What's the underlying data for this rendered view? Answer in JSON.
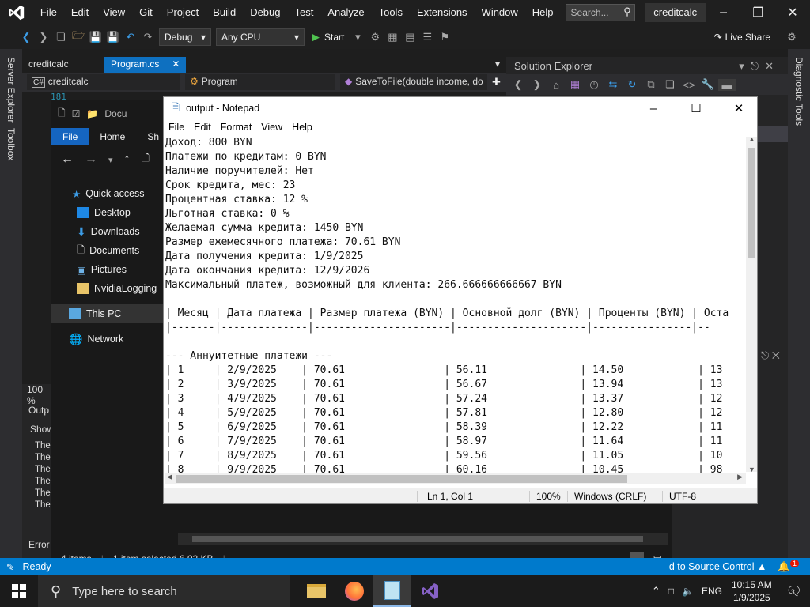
{
  "vs": {
    "menu": [
      "File",
      "Edit",
      "View",
      "Git",
      "Project",
      "Build",
      "Debug",
      "Test",
      "Analyze",
      "Tools",
      "Extensions",
      "Window",
      "Help"
    ],
    "search_placeholder": "Search...",
    "solution_name": "creditcalc",
    "toolbar": {
      "config": "Debug",
      "platform": "Any CPU",
      "start": "Start",
      "live_share": "Live Share"
    },
    "left_strip": [
      "Server Explorer",
      "Toolbox"
    ],
    "right_strip": [
      "Diagnostic Tools"
    ],
    "tabs": [
      {
        "label": "creditcalc"
      },
      {
        "label": "Program.cs"
      }
    ],
    "nav": {
      "project": "creditcalc",
      "class": "Program",
      "method": "SaveToFile(double income, do"
    },
    "line_number": "181",
    "solution_explorer_title": "Solution Explorer",
    "zoom": "100 %",
    "output": {
      "label": "Outp",
      "show": "Show",
      "lines": [
        "The",
        "The",
        "The",
        "The",
        "The",
        "The"
      ]
    },
    "error_label": "Error",
    "status": {
      "left": "Ready",
      "right": "d to Source Control",
      "notif_count": "1"
    }
  },
  "explorer": {
    "title": "Docu",
    "ribbon": [
      "File",
      "Home",
      "Sh"
    ],
    "tree": [
      {
        "label": "Quick access",
        "icon": "star-icon"
      },
      {
        "label": "Desktop",
        "icon": "desktop-icon"
      },
      {
        "label": "Downloads",
        "icon": "download-icon"
      },
      {
        "label": "Documents",
        "icon": "documents-icon"
      },
      {
        "label": "Pictures",
        "icon": "pictures-icon"
      },
      {
        "label": "NvidiaLogging",
        "icon": "folder-icon"
      },
      {
        "label": "This PC",
        "icon": "computer-icon"
      },
      {
        "label": "Network",
        "icon": "network-icon"
      }
    ],
    "status": {
      "items": "4 items",
      "selected": "1 item selected 6.02 KB"
    }
  },
  "notepad": {
    "title": "output - Notepad",
    "menu": [
      "File",
      "Edit",
      "Format",
      "View",
      "Help"
    ],
    "lines": [
      "Доход: 800 BYN",
      "Платежи по кредитам: 0 BYN",
      "Наличие поручителей: Нет",
      "Срок кредита, мес: 23",
      "Процентная ставка: 12 %",
      "Льготная ставка: 0 %",
      "Желаемая сумма кредита: 1450 BYN",
      "Размер ежемесячного платежа: 70.61 BYN",
      "Дата получения кредита: 1/9/2025",
      "Дата окончания кредита: 12/9/2026",
      "Максимальный платеж, возможный для клиента: 266.666666666667 BYN",
      "",
      "| Месяц | Дата платежа | Размер платежа (BYN) | Основной долг (BYN) | Проценты (BYN) | Оста",
      "|-------|--------------|----------------------|---------------------|----------------|--",
      "",
      "--- Аннуитетные платежи ---",
      "| 1     | 2/9/2025    | 70.61                | 56.11               | 14.50            | 13",
      "| 2     | 3/9/2025    | 70.61                | 56.67               | 13.94            | 13",
      "| 3     | 4/9/2025    | 70.61                | 57.24               | 13.37            | 12",
      "| 4     | 5/9/2025    | 70.61                | 57.81               | 12.80            | 12",
      "| 5     | 6/9/2025    | 70.61                | 58.39               | 12.22            | 11",
      "| 6     | 7/9/2025    | 70.61                | 58.97               | 11.64            | 11",
      "| 7     | 8/9/2025    | 70.61                | 59.56               | 11.05            | 10",
      "| 8     | 9/9/2025    | 70.61                | 60.16               | 10.45            | 98"
    ],
    "status": {
      "position": "Ln 1, Col 1",
      "zoom": "100%",
      "eol": "Windows (CRLF)",
      "encoding": "UTF-8"
    }
  },
  "taskbar": {
    "search_placeholder": "Type here to search",
    "lang": "ENG",
    "time": "10:15 AM",
    "date": "1/9/2025",
    "notif_count": "3"
  },
  "colors": {
    "vs_accent": "#007acc",
    "vs_tab_active": "#0e70c0",
    "vs_purple": "#8661c5"
  }
}
